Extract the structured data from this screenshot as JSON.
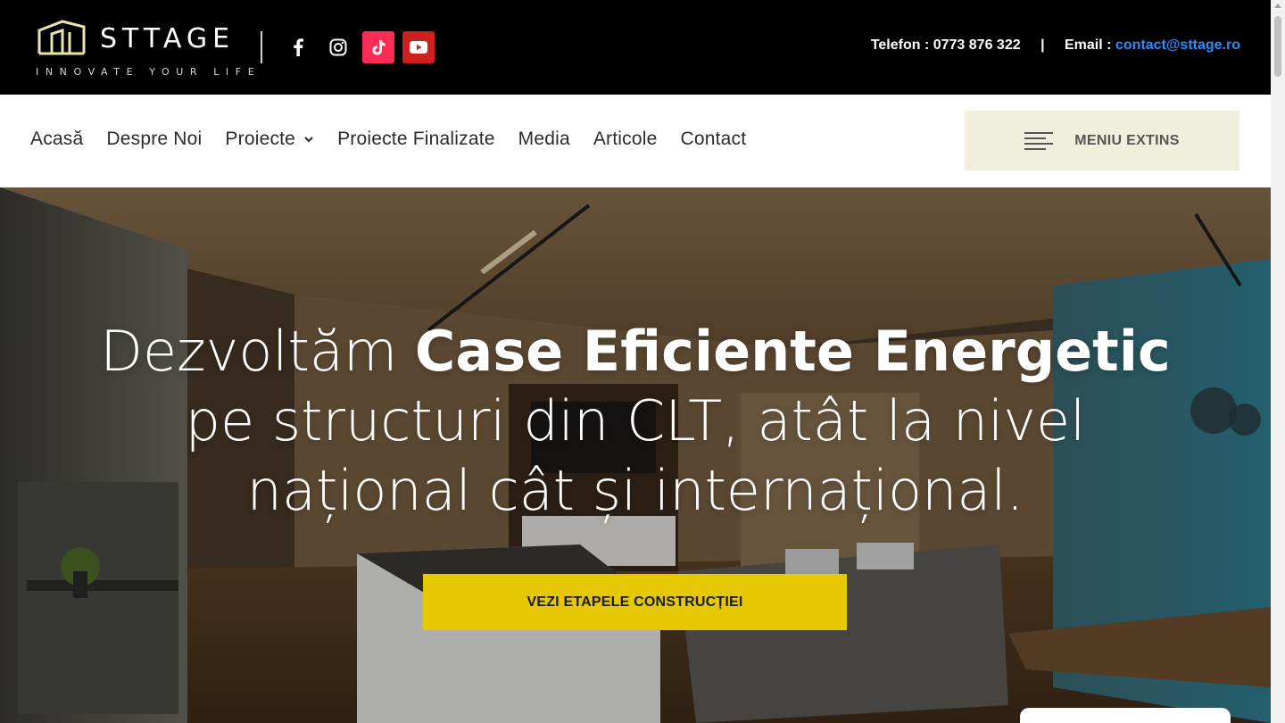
{
  "brand": {
    "name": "STTAGE",
    "tagline": "INNOVATE YOUR LIFE"
  },
  "social": [
    {
      "icon": "facebook-icon",
      "color": "#000000"
    },
    {
      "icon": "instagram-icon",
      "color": "#000000"
    },
    {
      "icon": "tiktok-icon",
      "color": "#fe2c55"
    },
    {
      "icon": "youtube-icon",
      "color": "#cd201f"
    }
  ],
  "contact": {
    "phone_label": "Telefon : 0773 876 322",
    "separator": "|",
    "email_label": "Email :",
    "email": "contact@sttage.ro"
  },
  "nav": {
    "items": [
      {
        "label": "Acasă"
      },
      {
        "label": "Despre Noi"
      },
      {
        "label": "Proiecte",
        "dropdown": true
      },
      {
        "label": "Proiecte Finalizate"
      },
      {
        "label": "Media"
      },
      {
        "label": "Articole"
      },
      {
        "label": "Contact"
      }
    ],
    "extended_menu_label": "MENIU EXTINS"
  },
  "hero": {
    "title_part1": "Dezvoltăm ",
    "title_bold": "Case Eficiente Energetic",
    "title_line2": "pe structuri din CLT, atât la nivel",
    "title_line3": "național cât și internațional.",
    "cta_label": "VEZI ETAPELE CONSTRUCȚIEI"
  },
  "colors": {
    "accent_yellow": "#e6c800",
    "menu_bg": "#efefdc",
    "link_blue": "#2a8dff"
  }
}
